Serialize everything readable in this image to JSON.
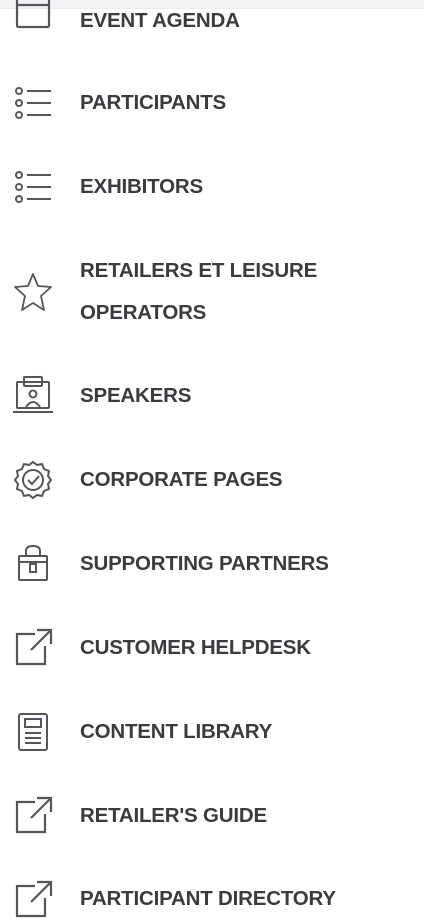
{
  "menu": {
    "items": [
      {
        "label": "EVENT AGENDA",
        "icon": "calendar-icon"
      },
      {
        "label": "PARTICIPANTS",
        "icon": "list-icon"
      },
      {
        "label": "EXHIBITORS",
        "icon": "list-icon"
      },
      {
        "label": "RETAILERS ET LEISURE OPERATORS",
        "icon": "star-icon"
      },
      {
        "label": "SPEAKERS",
        "icon": "speaker-presentation-icon"
      },
      {
        "label": "CORPORATE PAGES",
        "icon": "verified-badge-icon"
      },
      {
        "label": "SUPPORTING PARTNERS",
        "icon": "shopping-bag-icon"
      },
      {
        "label": "CUSTOMER HELPDESK",
        "icon": "external-link-icon"
      },
      {
        "label": "CONTENT LIBRARY",
        "icon": "document-icon"
      },
      {
        "label": "RETAILER'S GUIDE",
        "icon": "external-link-icon"
      },
      {
        "label": "PARTICIPANT DIRECTORY",
        "icon": "external-link-icon"
      }
    ]
  },
  "colors": {
    "text": "#3a3a40",
    "icon": "#555560",
    "background": "#ffffff"
  }
}
